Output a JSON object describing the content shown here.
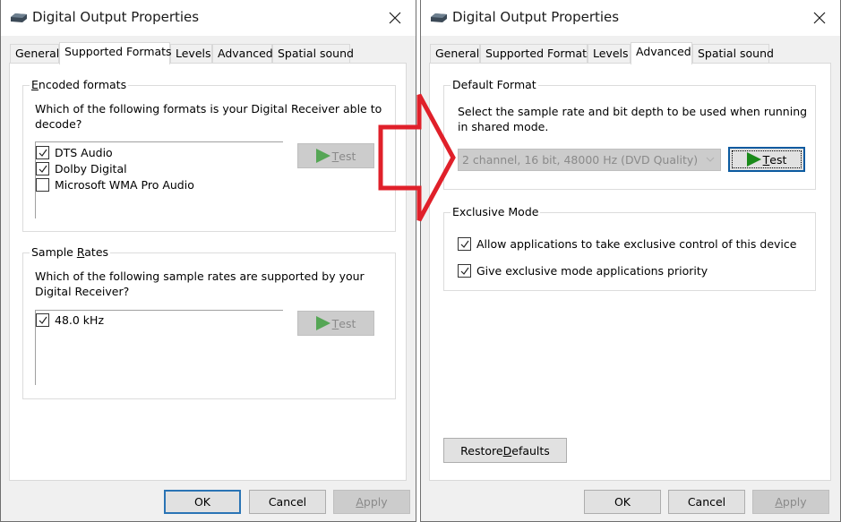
{
  "left_dialog": {
    "title": "Digital Output Properties",
    "icon": "speaker-device-icon",
    "tabs": [
      {
        "label": "General",
        "active": false
      },
      {
        "label": "Supported Formats",
        "active": true
      },
      {
        "label": "Levels",
        "active": false
      },
      {
        "label": "Advanced",
        "active": false
      },
      {
        "label": "Spatial sound",
        "active": false
      }
    ],
    "encoded_formats": {
      "title_hotkey": "E",
      "title_rest": "ncoded formats",
      "description": "Which of the following formats is your Digital Receiver able to decode?",
      "items": [
        {
          "label": "DTS Audio",
          "checked": true
        },
        {
          "label": "Dolby Digital",
          "checked": true
        },
        {
          "label": "Microsoft WMA Pro Audio",
          "checked": false
        }
      ],
      "test_hotkey": "T",
      "test_rest": "est",
      "test_enabled": false
    },
    "sample_rates": {
      "title_pre": "Sample ",
      "title_hotkey": "R",
      "title_rest": "ates",
      "description": "Which of the following sample rates are supported by your Digital Receiver?",
      "items": [
        {
          "label": "48.0 kHz",
          "checked": true
        }
      ],
      "test_hotkey": "T",
      "test_rest": "est",
      "test_enabled": false
    },
    "buttons": {
      "ok": "OK",
      "cancel": "Cancel",
      "apply_hotkey": "A",
      "apply_rest": "pply"
    }
  },
  "right_dialog": {
    "title": "Digital Output Properties",
    "icon": "speaker-device-icon",
    "tabs": [
      {
        "label": "General",
        "active": false
      },
      {
        "label": "Supported Formats",
        "active": false
      },
      {
        "label": "Levels",
        "active": false
      },
      {
        "label": "Advanced",
        "active": true
      },
      {
        "label": "Spatial sound",
        "active": false
      }
    ],
    "default_format": {
      "title": "Default Format",
      "description": "Select the sample rate and bit depth to be used when running in shared mode.",
      "selected_format": "2 channel, 16 bit, 48000 Hz (DVD Quality)",
      "combo_enabled": false,
      "test_hotkey": "T",
      "test_rest": "est"
    },
    "exclusive_mode": {
      "title": "Exclusive Mode",
      "items": [
        {
          "label": "Allow applications to take exclusive control of this device",
          "checked": true
        },
        {
          "label": "Give exclusive mode applications priority",
          "checked": true
        }
      ]
    },
    "restore_defaults": {
      "pre": "Restore ",
      "hotkey": "D",
      "rest": "efaults"
    },
    "buttons": {
      "ok": "OK",
      "cancel": "Cancel",
      "apply_hotkey": "A",
      "apply_rest": "pply"
    }
  },
  "annotation": {
    "type": "red-arrow-right",
    "color": "#e0202a"
  }
}
